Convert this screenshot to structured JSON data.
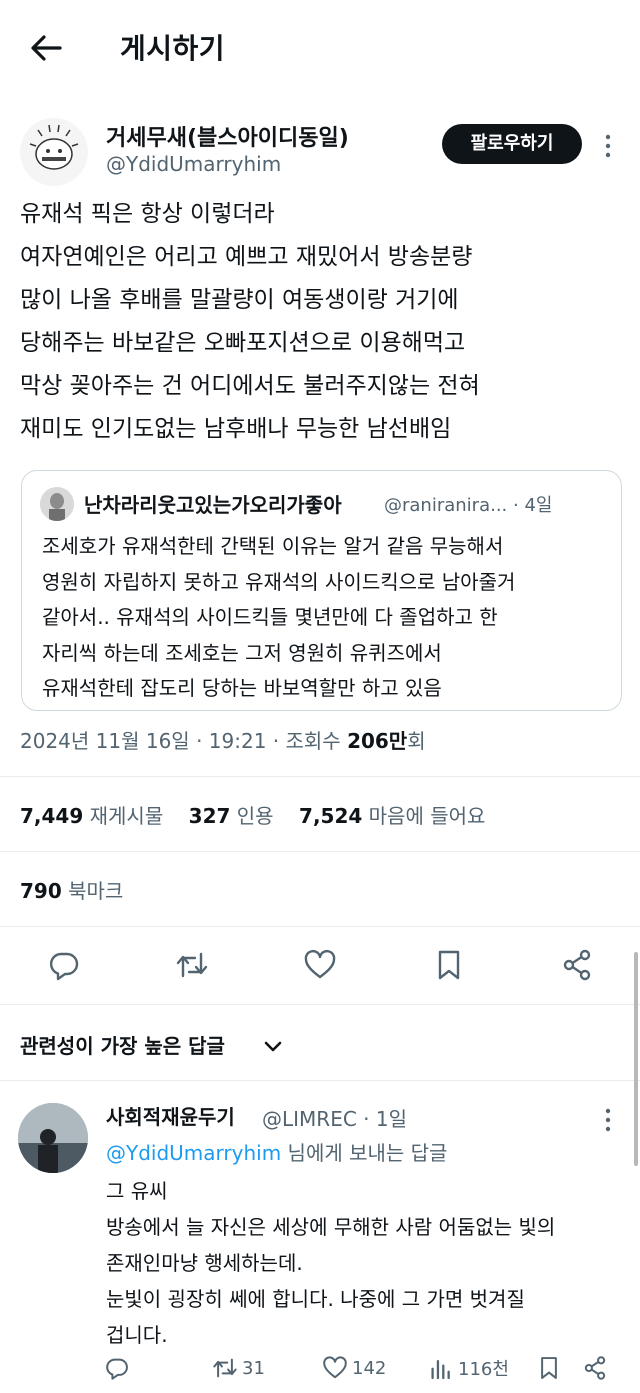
{
  "topbar": {
    "title": "게시하기"
  },
  "post": {
    "author_name": "거세무새(블스아이디동일)",
    "author_handle": "@YdidUmarryhim",
    "follow_label": "팔로우하기",
    "body": "유재석 픽은 항상 이렇더라\n여자연예인은 어리고 예쁘고 재밌어서 방송분량\n많이 나올 후배를 말괄량이 여동생이랑 거기에\n당해주는 바보같은 오빠포지션으로 이용해먹고\n막상 꽂아주는 건 어디에서도 불러주지않는 전혀\n재미도 인기도없는 남후배나 무능한 남선배임",
    "quote": {
      "author_name": "난차라리웃고있는가오리가좋아",
      "handle_time": "@raniranira... · 4일",
      "body": "조세호가 유재석한테 간택된 이유는 알거 같음 무능해서\n영원히 자립하지 못하고 유재석의 사이드킥으로 남아줄거\n같아서.. 유재석의 사이드킥들 몇년만에 다 졸업하고 한\n자리씩 하는데 조세호는 그저 영원히 유퀴즈에서\n유재석한테 잡도리 당하는 바보역할만  하고 있음"
    },
    "meta_time": "2024년 11월 16일 · 19:21 · 조회수 ",
    "meta_views": "206만",
    "meta_views_suffix": "회",
    "stats": {
      "retweets": "7,449",
      "retweets_label": "재게시물",
      "quotes": "327",
      "quotes_label": "인용",
      "likes": "7,524",
      "likes_label": "마음에 들어요"
    },
    "bookmarks": "790",
    "bookmarks_label": "북마크"
  },
  "sort": {
    "label": "관련성이 가장 높은 답글"
  },
  "reply": {
    "author_name": "사회적재윤두기",
    "handle_time": "@LIMREC · 1일",
    "reply_to_handle": "@YdidUmarryhim",
    "reply_to_suffix": " 님에게 보내는 답글",
    "body": "그 유씨\n방송에서 늘 자신은 세상에 무해한 사람 어둠없는 빛의\n존재인마냥 행세하는데.\n눈빛이 굉장히 쎄에 합니다. 나중에 그 가면 벗겨질\n겁니다.",
    "retweets": "31",
    "likes": "142",
    "views": "116천"
  }
}
